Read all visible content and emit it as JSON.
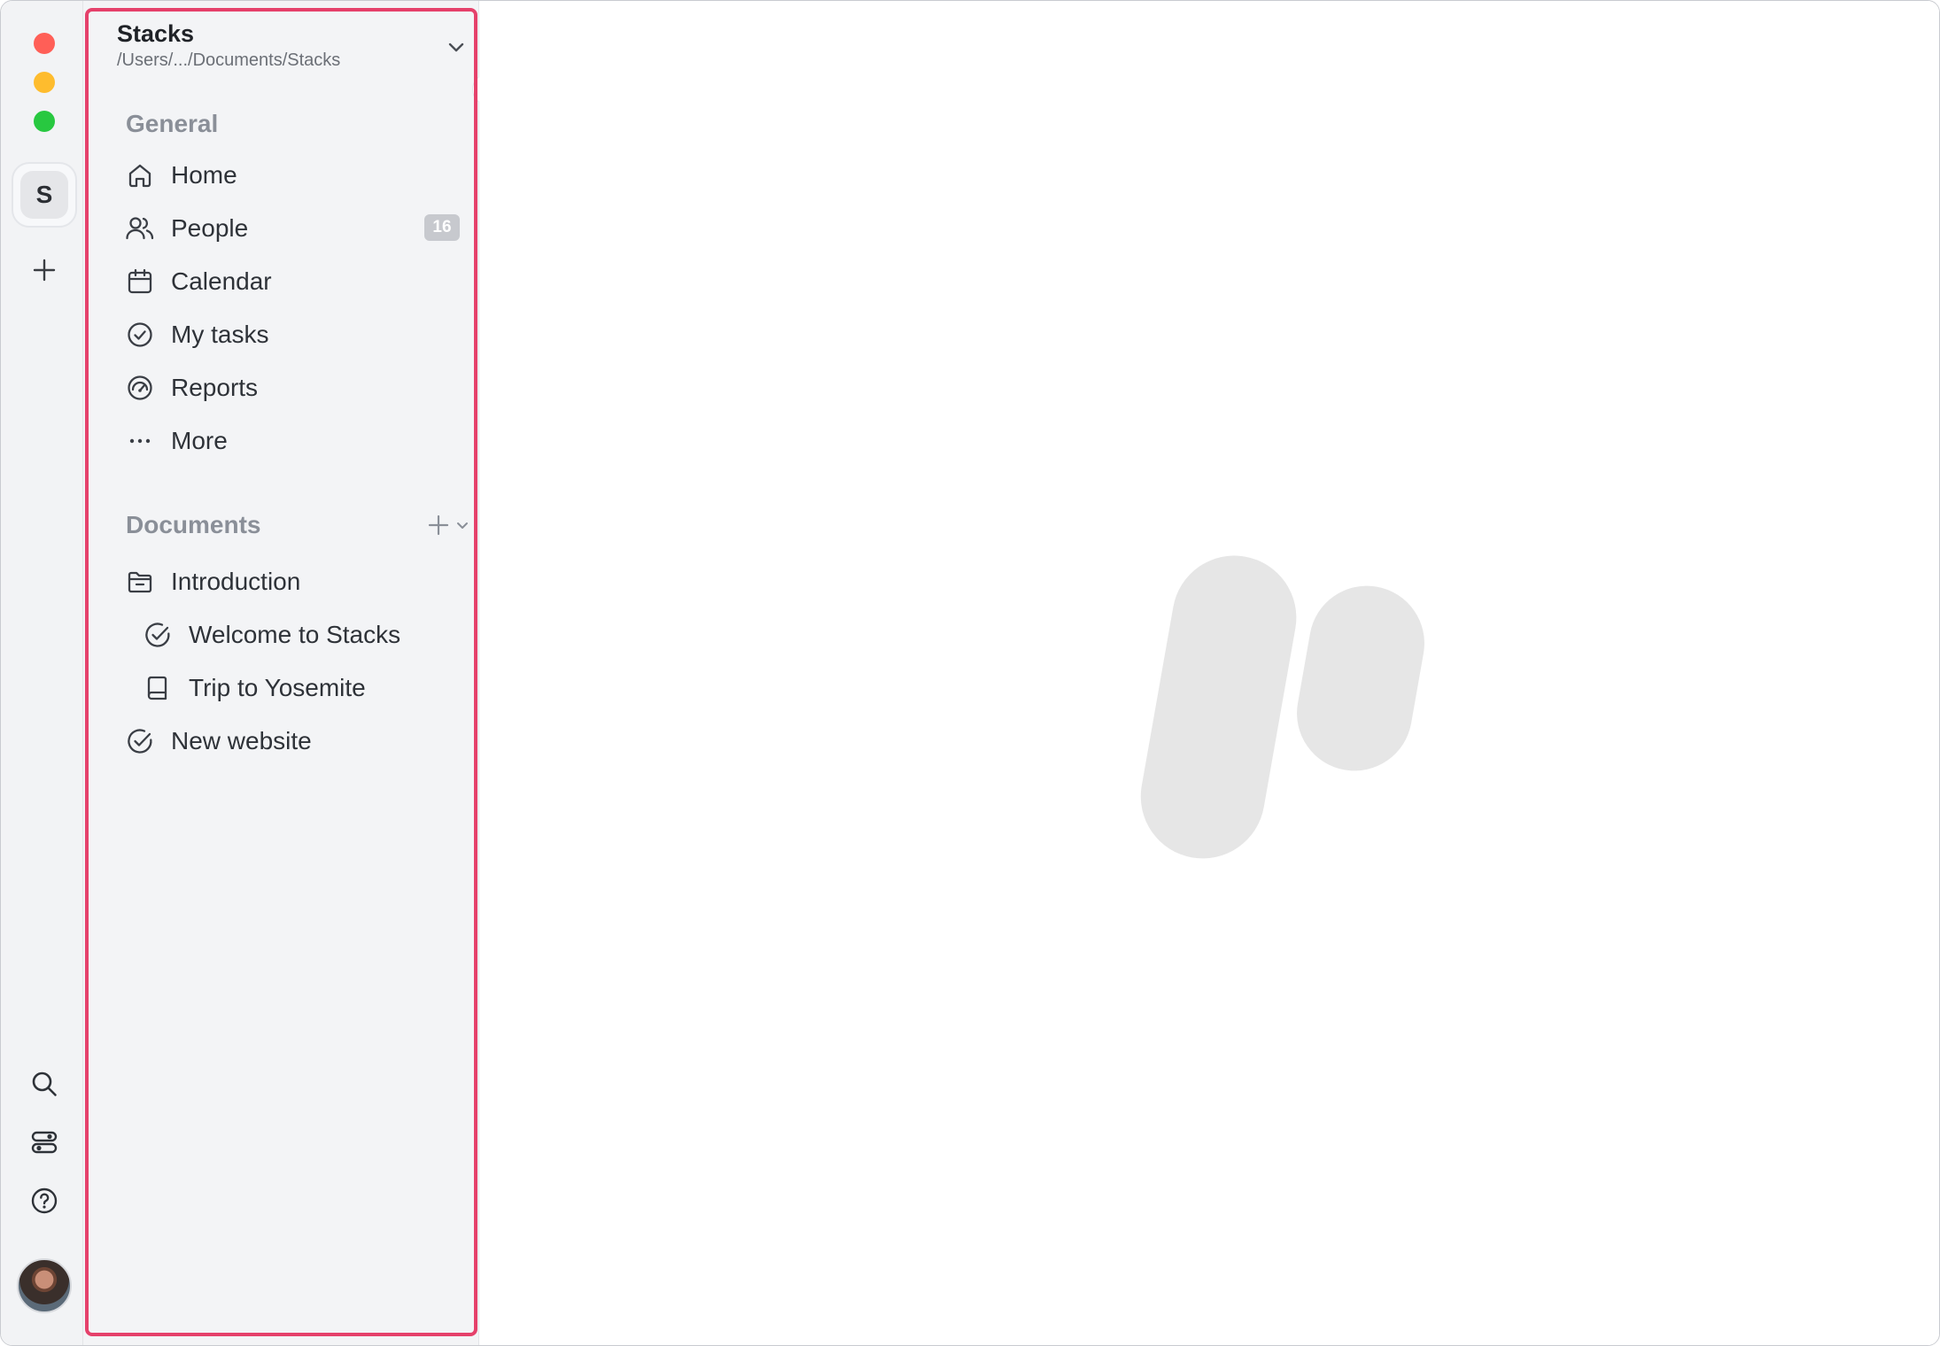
{
  "workspace": {
    "title": "Stacks",
    "path": "/Users/.../Documents/Stacks",
    "initial": "S"
  },
  "general": {
    "title": "General",
    "items": [
      {
        "label": "Home",
        "icon": "home-icon"
      },
      {
        "label": "People",
        "icon": "people-icon",
        "badge": "16"
      },
      {
        "label": "Calendar",
        "icon": "calendar-icon"
      },
      {
        "label": "My tasks",
        "icon": "check-circle-icon"
      },
      {
        "label": "Reports",
        "icon": "gauge-icon"
      },
      {
        "label": "More",
        "icon": "more-dots-icon"
      }
    ]
  },
  "documents": {
    "title": "Documents",
    "items": [
      {
        "label": "Introduction",
        "icon": "folder-icon"
      },
      {
        "label": "Welcome to Stacks",
        "icon": "check-circle-icon"
      },
      {
        "label": "Trip to Yosemite",
        "icon": "book-icon"
      },
      {
        "label": "New website",
        "icon": "check-circle-icon"
      }
    ]
  },
  "colors": {
    "highlight": "#e5416b",
    "sidebar_bg": "#f3f4f6",
    "logo": "#e6e6e6"
  }
}
